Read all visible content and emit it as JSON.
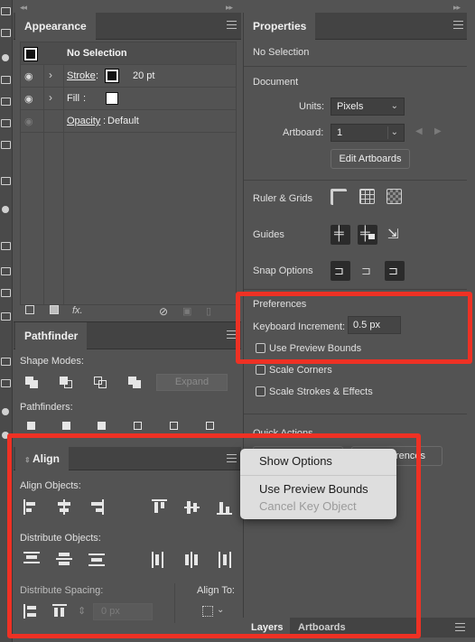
{
  "appearance": {
    "tab_label": "Appearance",
    "no_selection": "No Selection",
    "stroke_label": "Stroke",
    "stroke_value": "20 pt",
    "fill_label": "Fill",
    "opacity_label": "Opacity",
    "opacity_value": "Default",
    "fx_label": "fx."
  },
  "pathfinder": {
    "tab_label": "Pathfinder",
    "shape_modes_label": "Shape Modes:",
    "expand_label": "Expand",
    "pathfinders_label": "Pathfinders:"
  },
  "align": {
    "tab_label": "Align",
    "align_objects_label": "Align Objects:",
    "distribute_objects_label": "Distribute Objects:",
    "distribute_spacing_label": "Distribute Spacing:",
    "align_to_label": "Align To:",
    "spacing_value": "0 px"
  },
  "properties": {
    "tab_label": "Properties",
    "no_selection": "No Selection",
    "document_label": "Document",
    "units_label": "Units:",
    "units_value": "Pixels",
    "artboard_label": "Artboard:",
    "artboard_value": "1",
    "edit_artboards_label": "Edit Artboards",
    "ruler_grids_label": "Ruler & Grids",
    "guides_label": "Guides",
    "snap_options_label": "Snap Options",
    "preferences_label": "Preferences",
    "keyboard_increment_label": "Keyboard Increment:",
    "keyboard_increment_value": "0.5 px",
    "use_preview_bounds_label": "Use Preview Bounds",
    "scale_corners_label": "Scale Corners",
    "scale_strokes_label": "Scale Strokes & Effects",
    "quick_actions_label": "Quick Actions",
    "obscured_button_label": "rences"
  },
  "bottom_tabs": [
    "Layers",
    "Artboards"
  ],
  "context_menu": {
    "items": [
      "Show Options",
      "Use Preview Bounds",
      "Cancel Key Object"
    ]
  },
  "colors": {
    "highlight": "#ee3124",
    "panel_bg": "#535353",
    "tab_bar_bg": "#434343"
  }
}
